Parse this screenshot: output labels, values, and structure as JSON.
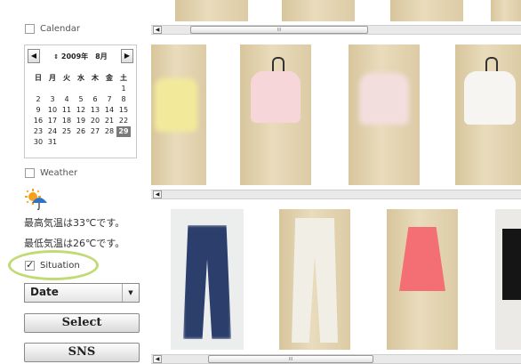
{
  "sidebar": {
    "calendar_label": "Calendar",
    "calendar": {
      "month_label": "2009年　8月",
      "prev_icon": "◀",
      "next_icon": "▶",
      "weekdays": [
        "日",
        "月",
        "火",
        "水",
        "木",
        "金",
        "土"
      ],
      "weeks": [
        [
          "",
          "",
          "",
          "",
          "",
          "",
          "1"
        ],
        [
          "2",
          "3",
          "4",
          "5",
          "6",
          "7",
          "8"
        ],
        [
          "9",
          "10",
          "11",
          "12",
          "13",
          "14",
          "15"
        ],
        [
          "16",
          "17",
          "18",
          "19",
          "20",
          "21",
          "22"
        ],
        [
          "23",
          "24",
          "25",
          "26",
          "27",
          "28",
          "29"
        ],
        [
          "30",
          "31",
          "",
          "",
          "",
          "",
          ""
        ]
      ],
      "selected_day": "29"
    },
    "weather_label": "Weather",
    "weather_icon": "sun-umbrella-icon",
    "max_temp_text": "最高気温は33℃です。",
    "min_temp_text": "最低気温は26℃です。",
    "situation_label": "Situation",
    "situation_checked": true,
    "select_value": "Date",
    "select_button": "Select",
    "sns_button": "SNS"
  },
  "gallery": {
    "scroll_thumb_glyph": "III",
    "rows": [
      {
        "name": "tops",
        "items": [
          "yellow-top",
          "pink-blouse",
          "pink-top",
          "white-blouse"
        ]
      },
      {
        "name": "bottoms",
        "items": [
          "blue-jeans",
          "white-pants",
          "pink-skirt",
          "black-skirt"
        ]
      }
    ]
  }
}
